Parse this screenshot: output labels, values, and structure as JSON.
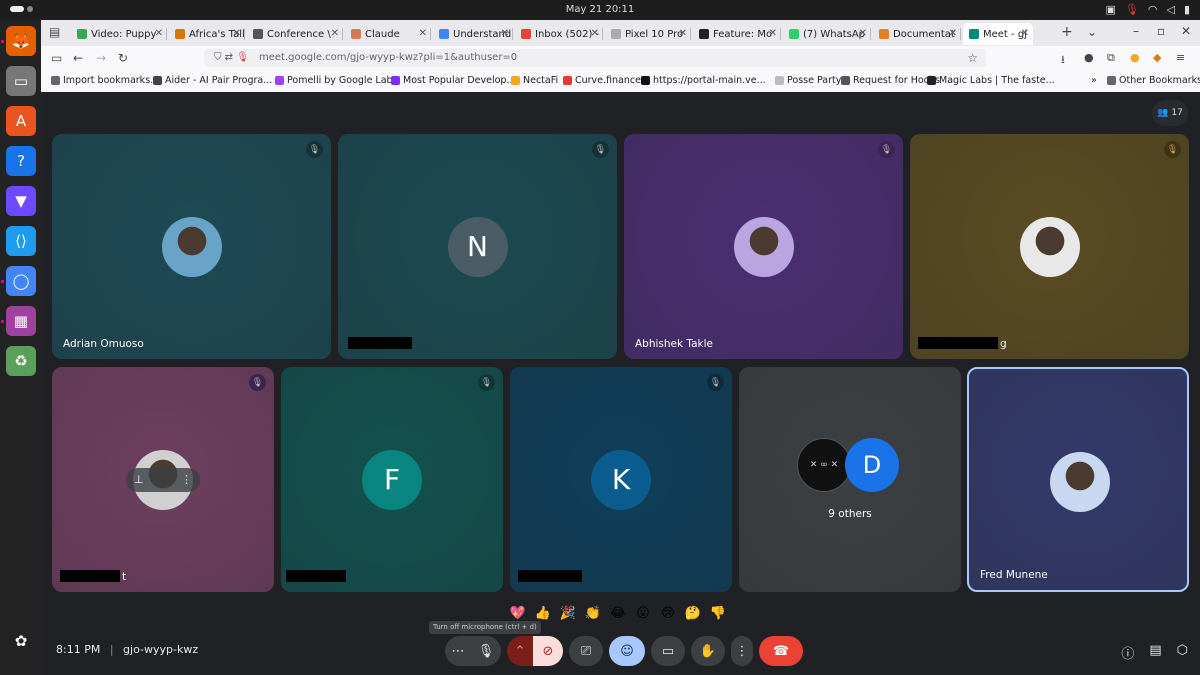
{
  "os": {
    "clock": "May 21  20:11",
    "sysicons": [
      "camera-icon",
      "mic-icon",
      "wifi-icon",
      "volume-icon",
      "battery-icon"
    ]
  },
  "dock": {
    "apps": [
      {
        "name": "firefox",
        "color": "#e66000",
        "glyph": "🦊"
      },
      {
        "name": "files",
        "color": "#777",
        "glyph": "▭"
      },
      {
        "name": "app-center",
        "color": "#e95420",
        "glyph": "A"
      },
      {
        "name": "help",
        "color": "#1a73e8",
        "glyph": "?"
      },
      {
        "name": "proton-vpn",
        "color": "#6d4aff",
        "glyph": "▼"
      },
      {
        "name": "vscode",
        "color": "#1f9cf0",
        "glyph": "⟨⟩"
      },
      {
        "name": "chromium",
        "color": "#4285f4",
        "glyph": "◯"
      },
      {
        "name": "screen-recorder",
        "color": "#a040a0",
        "glyph": "▦"
      },
      {
        "name": "trash",
        "color": "#5aa05a",
        "glyph": "♻"
      },
      {
        "name": "ubuntu",
        "color": "#232323",
        "glyph": "✿"
      }
    ]
  },
  "browser": {
    "tabs": [
      {
        "label": "Video: Puppy",
        "fav_color": "#34a853",
        "active": false
      },
      {
        "label": "Africa's Talki",
        "fav_color": "#d97706",
        "active": false
      },
      {
        "label": "Conference \\",
        "fav_color": "#555",
        "active": false
      },
      {
        "label": "Claude",
        "fav_color": "#d97757",
        "active": false
      },
      {
        "label": "Understandi",
        "fav_color": "#4285f4",
        "active": false
      },
      {
        "label": "Inbox (502) -",
        "fav_color": "#ea4335",
        "active": false
      },
      {
        "label": "Pixel 10 Pro",
        "fav_color": "#aaa",
        "active": false
      },
      {
        "label": "Feature: Mo",
        "fav_color": "#222",
        "active": false
      },
      {
        "label": "(7) WhatsAp",
        "fav_color": "#25d366",
        "active": false
      },
      {
        "label": "Documentat",
        "fav_color": "#e67e22",
        "active": false
      },
      {
        "label": "Meet - gj",
        "fav_color": "#00897b",
        "active": true
      }
    ],
    "new_tab": "+",
    "url": "meet.google.com/gjo-wyyp-kwz?pli=1&authuser=0",
    "bookmarks": [
      {
        "label": "Import bookmarks...",
        "color": "#666"
      },
      {
        "label": "Aider - AI Pair Progra...",
        "color": "#444"
      },
      {
        "label": "Pomelli by Google Labs",
        "color": "#a142f4"
      },
      {
        "label": "Most Popular Develop...",
        "color": "#7b2ff7"
      },
      {
        "label": "NectaFi",
        "color": "#f5a623"
      },
      {
        "label": "Curve.finance",
        "color": "#e53935"
      },
      {
        "label": "https://portal-main.ve...",
        "color": "#111"
      },
      {
        "label": "Posse Party",
        "color": "#bbb"
      },
      {
        "label": "Request for Hooks",
        "color": "#555"
      },
      {
        "label": "Magic Labs | The faste...",
        "color": "#222"
      },
      {
        "label": "Other Bookmarks",
        "color": "#666"
      }
    ],
    "more_bookmarks": "»"
  },
  "meet": {
    "participant_count": "17",
    "tiles": [
      {
        "name": "Adrian Omuoso",
        "bg": "#1d4a55",
        "avatar_type": "photo",
        "avatar_color": "#6aa3c8"
      },
      {
        "name": "",
        "bg": "#1c4a52",
        "avatar_type": "letter",
        "letter": "N",
        "avatar_color": "#4a5d66"
      },
      {
        "name": "Abhishek Takle",
        "bg": "#4a2f72",
        "avatar_type": "photo",
        "avatar_color": "#b9a6e0"
      },
      {
        "name": "g",
        "bg": "#5a4c22",
        "avatar_type": "photo",
        "avatar_color": "#e8e8e8"
      },
      {
        "name": "t",
        "bg": "#6e3f60",
        "avatar_type": "photo",
        "avatar_color": "#d0d0d0"
      },
      {
        "name": "",
        "bg": "#12514f",
        "avatar_type": "letter",
        "letter": "F",
        "avatar_color": "#0b8580"
      },
      {
        "name": "",
        "bg": "#0f3f5a",
        "avatar_type": "letter",
        "letter": "K",
        "avatar_color": "#0b5c8f"
      },
      {
        "name": "",
        "bg": "#3c4043",
        "avatar_type": "group",
        "letter": "D",
        "avatar_color": "#1a73e8",
        "others_label": "9 others"
      },
      {
        "name": "Fred Munene",
        "bg": "#333a6a",
        "avatar_type": "photo",
        "avatar_color": "#c8d8f0"
      }
    ],
    "reactions": [
      "💖",
      "👍",
      "🎉",
      "👏",
      "😂",
      "😮",
      "😢",
      "🤔",
      "👎"
    ],
    "tooltip": "Turn off microphone (ctrl + d)",
    "time": "8:11 PM",
    "meeting_code": "gjo-wyyp-kwz",
    "accent_end_call": "#ea4335",
    "accent_cam_off": "#f9dedc"
  }
}
